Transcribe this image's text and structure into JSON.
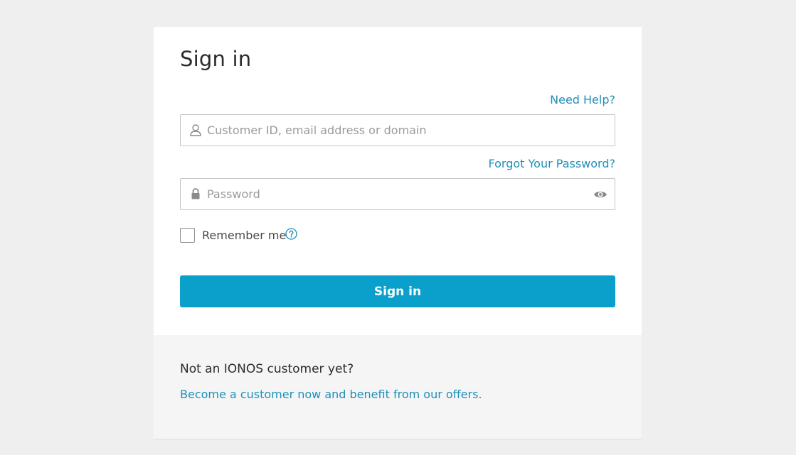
{
  "signin": {
    "title": "Sign in",
    "need_help_link": "Need Help?",
    "username": {
      "placeholder": "Customer ID, email address or domain",
      "value": "",
      "icon": "user-icon"
    },
    "forgot_password_link": "Forgot Your Password?",
    "password": {
      "placeholder": "Password",
      "value": "",
      "icon": "lock-icon",
      "toggle_icon": "eye-icon"
    },
    "remember_me": {
      "label": "Remember me",
      "checked": false,
      "help_icon": "question-circle-icon"
    },
    "submit_label": "Sign in"
  },
  "footer": {
    "question": "Not an IONOS customer yet?",
    "become_link": "Become a customer now and benefit from our offers."
  },
  "colors": {
    "accent": "#0ba0cb",
    "link": "#1f8fb8",
    "page_background": "#efefef",
    "footer_background": "#f5f5f5"
  }
}
